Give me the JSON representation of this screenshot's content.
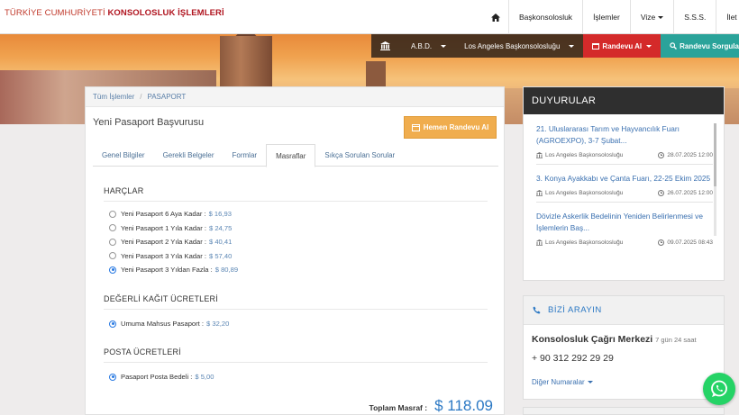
{
  "brand": {
    "part1": "TÜRKİYE CUMHURİYETİ ",
    "part2": "KONSOLOSLUK İŞLEMLERİ"
  },
  "topnav": {
    "items": [
      "Başkonsolosluk",
      "İşlemler",
      "Vize",
      "S.S.S.",
      "İlet"
    ]
  },
  "subnav": {
    "country": "A.B.D.",
    "consulate": "Los Angeles Başkonsolosluğu",
    "appointment": "Randevu Al",
    "appointment_query": "Randevu Sorgula"
  },
  "breadcrumb": {
    "root": "Tüm İşlemler",
    "current": "PASAPORT"
  },
  "page": {
    "title": "Yeni Pasaport Başvurusu",
    "appt_button": "Hemen Randevu Al"
  },
  "tabs": [
    "Genel Bilgiler",
    "Gerekli Belgeler",
    "Formlar",
    "Masraflar",
    "Sıkça Sorulan Sorular"
  ],
  "fees": {
    "harclar": {
      "heading": "HARÇLAR",
      "options": [
        {
          "label": "Yeni Pasaport 6 Aya Kadar :",
          "price": "$ 16,93",
          "selected": false
        },
        {
          "label": "Yeni Pasaport 1 Yıla Kadar :",
          "price": "$ 24,75",
          "selected": false
        },
        {
          "label": "Yeni Pasaport 2 Yıla Kadar :",
          "price": "$ 40,41",
          "selected": false
        },
        {
          "label": "Yeni Pasaport 3 Yıla Kadar :",
          "price": "$ 57,40",
          "selected": false
        },
        {
          "label": "Yeni Pasaport 3 Yıldan Fazla :",
          "price": "$ 80,89",
          "selected": true
        }
      ]
    },
    "degerli": {
      "heading": "DEĞERLİ KAĞIT ÜCRETLERİ",
      "options": [
        {
          "label": "Umuma Mahsus Pasaport :",
          "price": "$ 32,20",
          "selected": true
        }
      ]
    },
    "posta": {
      "heading": "POSTA ÜCRETLERİ",
      "options": [
        {
          "label": "Pasaport Posta Bedeli :",
          "price": "$ 5,00",
          "selected": true
        }
      ]
    },
    "total_label": "Toplam Masraf :",
    "total_value": "$ 118.09"
  },
  "announcements": {
    "heading": "DUYURULAR",
    "items": [
      {
        "title": "21. Uluslararası Tarım ve Hayvancılık Fuarı (AGROEXPO), 3-7 Şubat...",
        "office": "Los Angeles Başkonsolosluğu",
        "date": "28.07.2025 12:00"
      },
      {
        "title": "3. Konya Ayakkabı ve Çanta Fuarı, 22-25 Ekim 2025",
        "office": "Los Angeles Başkonsolosluğu",
        "date": "26.07.2025 12:00"
      },
      {
        "title": "Dövizle Askerlik Bedelinin Yeniden Belirlenmesi ve İşlemlerin Baş...",
        "office": "Los Angeles Başkonsolosluğu",
        "date": "09.07.2025 08:43"
      }
    ]
  },
  "call": {
    "heading": "BİZİ ARAYIN",
    "center": "Konsolosluk Çağrı Merkezi",
    "hours": "7 gün 24 saat",
    "phone": "+ 90 312 292 29 29",
    "other": "Diğer Numaralar"
  },
  "colors": {
    "brand_red": "#b0141f",
    "link_blue": "#3a70b0",
    "appt_orange": "#f0ad4e",
    "randevu_red": "#d42a2a",
    "sorgula_teal": "#2aa39a",
    "whatsapp": "#25d366"
  }
}
